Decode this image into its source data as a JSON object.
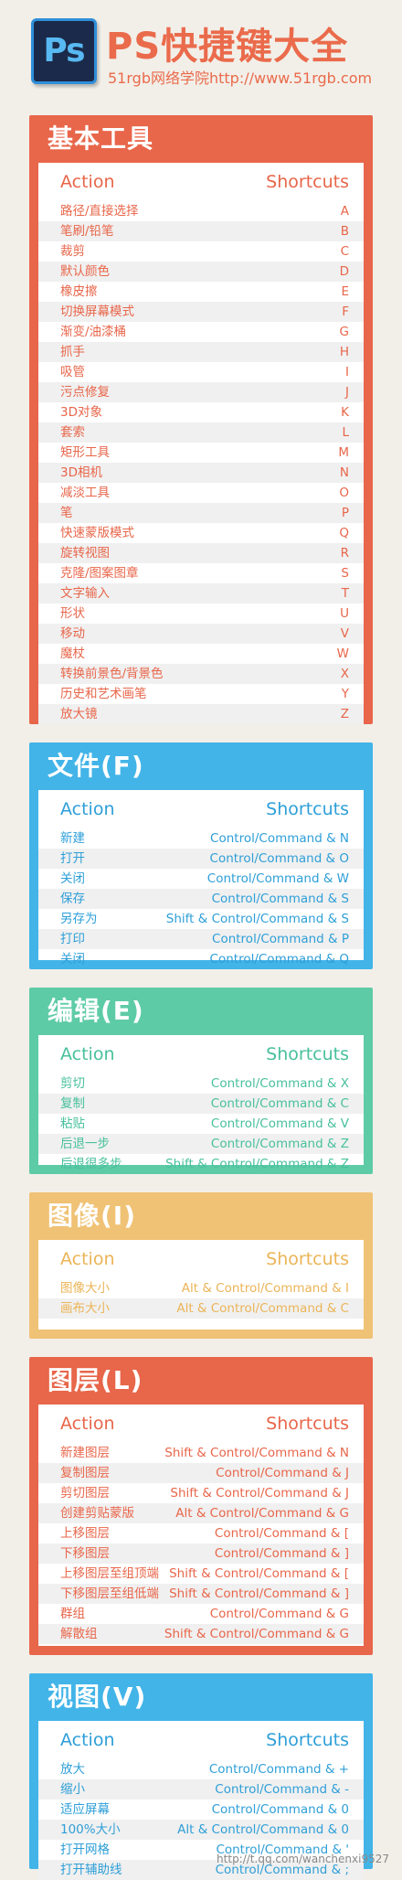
{
  "header": {
    "logo": "Ps",
    "title": "PS快捷键大全",
    "subtitle": "51rgb网络学院http://www.51rgb.com"
  },
  "columns": {
    "action": "Action",
    "shortcuts": "Shortcuts"
  },
  "sections": [
    {
      "title": "基本工具",
      "color": "#e8664a",
      "text_color": "#e8664a",
      "rows": [
        [
          "路径/直接选择",
          "A"
        ],
        [
          "笔刷/铅笔",
          "B"
        ],
        [
          "裁剪",
          "C"
        ],
        [
          "默认颜色",
          "D"
        ],
        [
          "橡皮擦",
          "E"
        ],
        [
          "切换屏幕模式",
          "F"
        ],
        [
          "渐变/油漆桶",
          "G"
        ],
        [
          "抓手",
          "H"
        ],
        [
          "吸管",
          "I"
        ],
        [
          "污点修复",
          "J"
        ],
        [
          "3D对象",
          "K"
        ],
        [
          "套索",
          "L"
        ],
        [
          "矩形工具",
          "M"
        ],
        [
          "3D相机",
          "N"
        ],
        [
          "减淡工具",
          "O"
        ],
        [
          "笔",
          "P"
        ],
        [
          "快速蒙版模式",
          "Q"
        ],
        [
          "旋转视图",
          "R"
        ],
        [
          "克隆/图案图章",
          "S"
        ],
        [
          "文字输入",
          "T"
        ],
        [
          "形状",
          "U"
        ],
        [
          "移动",
          "V"
        ],
        [
          "魔杖",
          "W"
        ],
        [
          "转换前景色/背景色",
          "X"
        ],
        [
          "历史和艺术画笔",
          "Y"
        ],
        [
          "放大镜",
          "Z"
        ]
      ]
    },
    {
      "title": "文件(F)",
      "color": "#42b4e8",
      "text_color": "#2e9fd8",
      "rows": [
        [
          "新建",
          "Control/Command & N"
        ],
        [
          "打开",
          "Control/Command & O"
        ],
        [
          "关闭",
          "Control/Command & W"
        ],
        [
          "保存",
          "Control/Command & S"
        ],
        [
          "另存为",
          "Shift & Control/Command & S"
        ],
        [
          "打印",
          "Control/Command & P"
        ],
        [
          "关闭",
          "Control/Command & Q"
        ]
      ]
    },
    {
      "title": "编辑(E)",
      "color": "#5ecba7",
      "text_color": "#48c09c",
      "rows": [
        [
          "剪切",
          "Control/Command & X"
        ],
        [
          "复制",
          "Control/Command & C"
        ],
        [
          "粘贴",
          "Control/Command & V"
        ],
        [
          "后退一步",
          "Control/Command & Z"
        ],
        [
          "后退很多步",
          "Shift & Control/Command & Z"
        ]
      ]
    },
    {
      "title": "图像(I)",
      "color": "#f0c275",
      "text_color": "#ebb457",
      "rows": [
        [
          "图像大小",
          "Alt & Control/Command & I"
        ],
        [
          "画布大小",
          "Alt & Control/Command & C"
        ]
      ]
    },
    {
      "title": "图层(L)",
      "color": "#e8664a",
      "text_color": "#e8664a",
      "rows": [
        [
          "新建图层",
          "Shift & Control/Command & N"
        ],
        [
          "复制图层",
          "Control/Command & J"
        ],
        [
          "剪切图层",
          "Shift & Control/Command & J"
        ],
        [
          "创建剪贴蒙版",
          "Alt & Control/Command & G"
        ],
        [
          "上移图层",
          "Control/Command & ["
        ],
        [
          "下移图层",
          "Control/Command & ]"
        ],
        [
          "上移图层至组顶端",
          "Shift & Control/Command & ["
        ],
        [
          "下移图层至组低端",
          "Shift & Control/Command & ]"
        ],
        [
          "群组",
          "Control/Command & G"
        ],
        [
          "解散组",
          "Shift & Control/Command & G"
        ]
      ]
    },
    {
      "title": "视图(V)",
      "color": "#42b4e8",
      "text_color": "#2e9fd8",
      "rows": [
        [
          "放大",
          "Control/Command & +"
        ],
        [
          "缩小",
          "Control/Command & -"
        ],
        [
          "适应屏幕",
          "Control/Command & 0"
        ],
        [
          "100%大小",
          "Alt & Control/Command & 0"
        ],
        [
          "打开网格",
          "Control/Command & '"
        ],
        [
          "打开辅助线",
          "Control/Command & ;"
        ]
      ]
    }
  ],
  "watermark": "http://t.qq.com/wanchenxi9527"
}
